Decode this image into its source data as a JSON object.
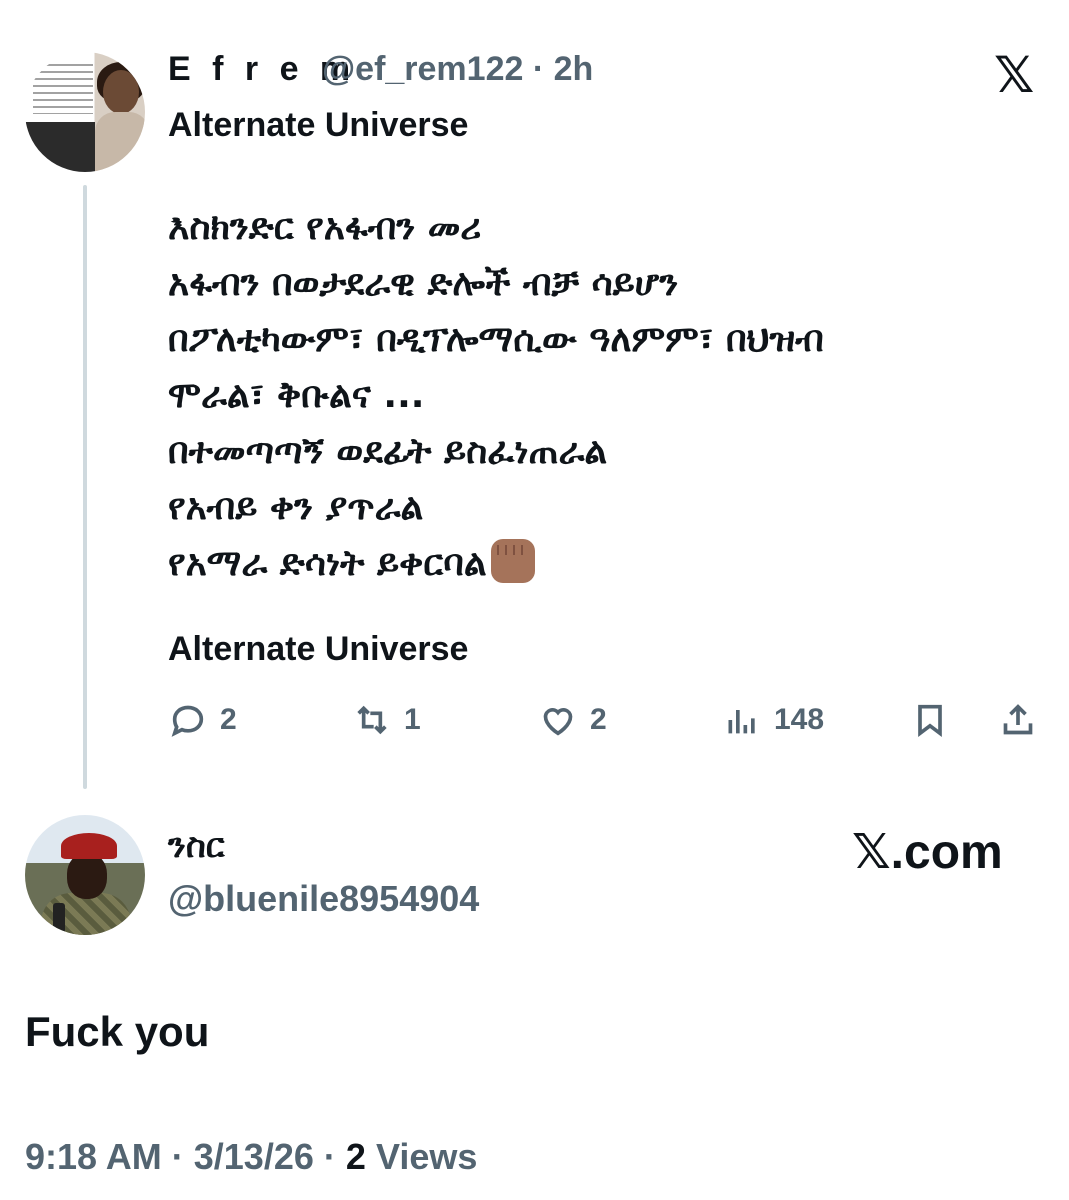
{
  "quoted_tweet": {
    "author_name": "E f r e m",
    "handle": "@ef_rem122",
    "separator": "·",
    "time_ago": "2h",
    "platform_icon": "x-logo-icon",
    "heading": "Alternate Universe",
    "body_lines": [
      "እስክንድር የአፋብን መሪ",
      "አፋብን በወታደራዊ ድሎች ብቻ ሳይሆን",
      "በፖለቲካውም፣ በዲፕሎማሲው ዓለምም፣ በህዝብ",
      "ሞራል፣ ቅቡልና ...",
      "በተመጣጣኝ ወደፊት ይስፈነጠራል",
      "የአብይ ቀን ያጥራል",
      "የአማራ ድሳነት ይቀርባል"
    ],
    "body_emoji": "raised-fist-emoji",
    "footer_heading": "Alternate Universe",
    "actions": {
      "replies": "2",
      "retweets": "1",
      "likes": "2",
      "views": "148"
    }
  },
  "reply_tweet": {
    "author_name": "ንስር",
    "handle": "@bluenile8954904",
    "watermark": "X.com",
    "text": "Fuck you",
    "time": "9:18 AM",
    "date": "3/13/26",
    "views_count": "2",
    "views_label": "Views",
    "separator": "·"
  }
}
